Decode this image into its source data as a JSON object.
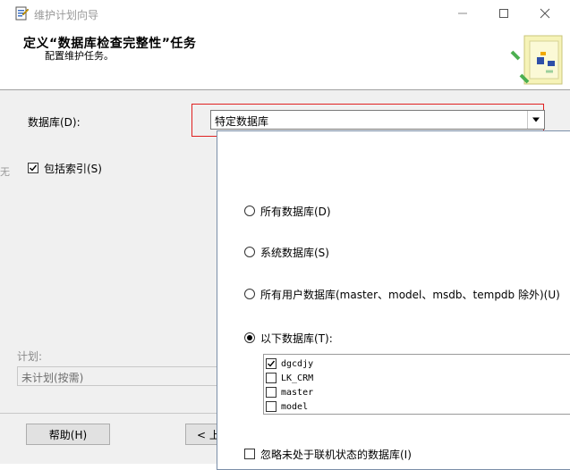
{
  "window": {
    "title": "维护计划向导"
  },
  "header": {
    "title": "定义“数据库检查完整性”任务",
    "subtitle": "配置维护任务。"
  },
  "form": {
    "database_label": "数据库(D):",
    "database_value": "特定数据库",
    "include_index_label": "包括索引(S)",
    "include_index_checked": true,
    "schedule_label": "计划:",
    "schedule_value": "未计划(按需)",
    "left_clipped_char": "无"
  },
  "popup": {
    "options": [
      {
        "label": "所有数据库(D)",
        "selected": false
      },
      {
        "label": "系统数据库(S)",
        "selected": false
      },
      {
        "label": "所有用户数据库(master、model、msdb、tempdb 除外)(U)",
        "selected": false
      },
      {
        "label": "以下数据库(T):",
        "selected": true
      }
    ],
    "databases": [
      {
        "name": "dgcdjy",
        "checked": true
      },
      {
        "name": "LK_CRM",
        "checked": false
      },
      {
        "name": "master",
        "checked": false
      },
      {
        "name": "model",
        "checked": false
      }
    ],
    "ignore_offline_label": "忽略未处于联机状态的数据库(I)",
    "ignore_offline_checked": false
  },
  "buttons": {
    "help": "帮助(H)",
    "back": "< 上"
  },
  "colors": {
    "focus_rect": "#e02020",
    "dialog_bg": "#f0f0f0",
    "popup_border": "#7a8ea8"
  }
}
